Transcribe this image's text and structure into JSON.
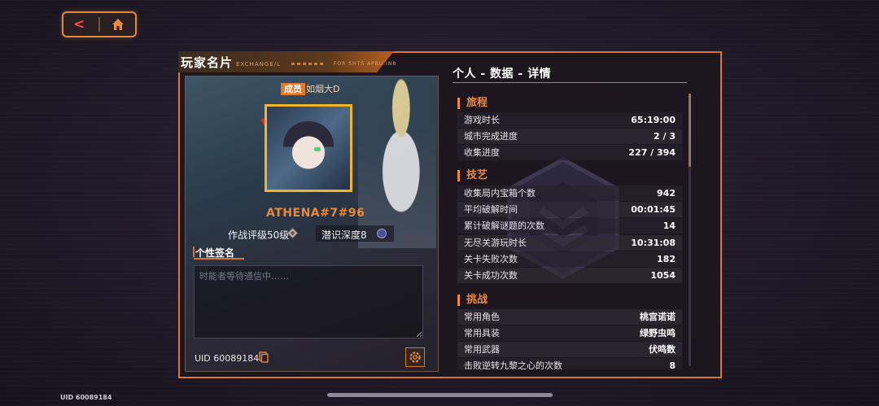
{
  "nav": {
    "back_icon": "back-arrow-icon",
    "home_icon": "home-icon"
  },
  "header": {
    "title": "玩家名片",
    "tag_left": "EXCHANGE/L",
    "tag_right": "FOR SHTS APBU.IN8"
  },
  "card": {
    "member_badge": "成员",
    "member_name": "如烟大D",
    "player_id": "ATHENA#7#96",
    "rating": "作战评级50级",
    "depth": "潜识深度8",
    "signature_label": "个性签名",
    "signature_placeholder": "时能者等待通信中……",
    "uid": "UID 60089184"
  },
  "stats": {
    "title": "个人 - 数据 - 详情",
    "sections": [
      {
        "title": "旅程",
        "rows": [
          {
            "label": "游戏时长",
            "value": "65:19:00"
          },
          {
            "label": "城市完成进度",
            "value": "2 / 3"
          },
          {
            "label": "收集进度",
            "value": "227 / 394"
          }
        ]
      },
      {
        "title": "技艺",
        "rows": [
          {
            "label": "收集局内宝箱个数",
            "value": "942"
          },
          {
            "label": "平均破解时间",
            "value": "00:01:45"
          },
          {
            "label": "累计破解谜题的次数",
            "value": "14"
          },
          {
            "label": "无尽关游玩时长",
            "value": "10:31:08"
          },
          {
            "label": "关卡失败次数",
            "value": "182"
          },
          {
            "label": "关卡成功次数",
            "value": "1054"
          }
        ]
      },
      {
        "title": "挑战",
        "rows": [
          {
            "label": "常用角色",
            "value": "桃宫诺诺"
          },
          {
            "label": "常用具装",
            "value": "绿野虫鸣"
          },
          {
            "label": "常用武器",
            "value": "伏鸣数"
          },
          {
            "label": "击败逆转九黎之心的次数",
            "value": "8"
          }
        ]
      }
    ]
  },
  "footer": {
    "uid": "UID 60089184"
  },
  "colors": {
    "accent": "#e98a3a",
    "frame": "#d9772e",
    "avatar_border": "#f2b529",
    "back": "#ff4a4a"
  }
}
